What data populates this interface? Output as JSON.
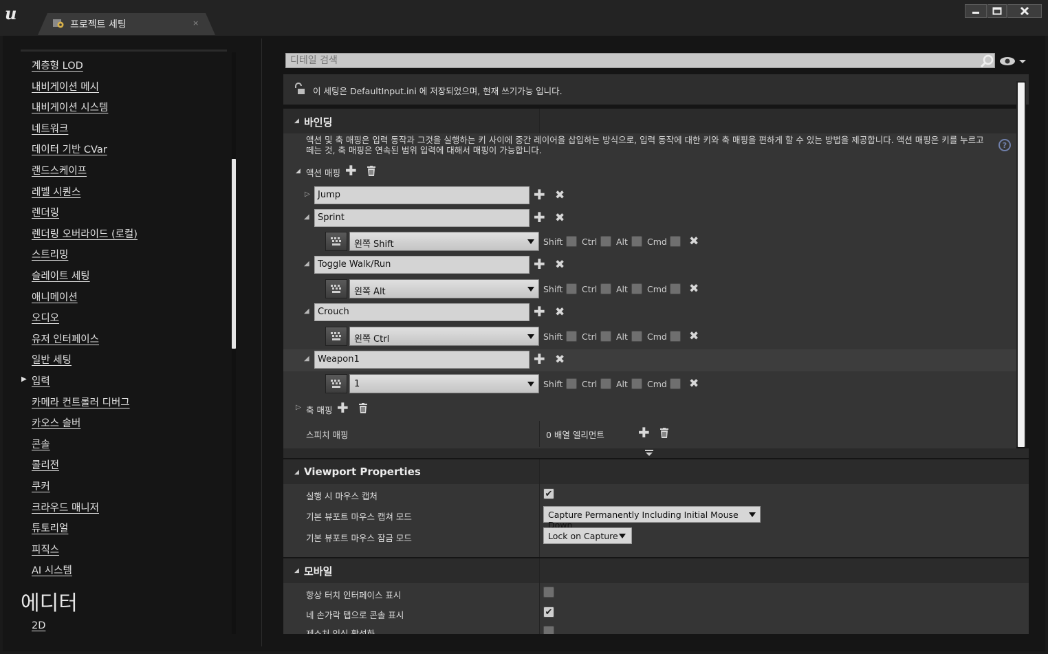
{
  "window": {
    "tab_label": "프로젝트 세팅",
    "tab_close": "×",
    "icons": {
      "logo": "unreal-logo",
      "tab": "settings-gear-icon",
      "minimize": "minimize-icon",
      "maximize": "maximize-icon",
      "close": "close-icon"
    }
  },
  "nav": {
    "items": [
      {
        "label": "계층형 LOD"
      },
      {
        "label": "내비게이션 메시"
      },
      {
        "label": "내비게이션 시스템"
      },
      {
        "label": "네트워크"
      },
      {
        "label": "데이터 기반 CVar"
      },
      {
        "label": "랜드스케이프"
      },
      {
        "label": "레벨 시퀀스"
      },
      {
        "label": "렌더링"
      },
      {
        "label": "렌더링 오버라이드 (로컬)"
      },
      {
        "label": "스트리밍"
      },
      {
        "label": "슬레이트 세팅"
      },
      {
        "label": "애니메이션"
      },
      {
        "label": "오디오"
      },
      {
        "label": "유저 인터페이스"
      },
      {
        "label": "일반 세팅"
      },
      {
        "label": "입력",
        "selected": true
      },
      {
        "label": "카메라 컨트롤러 디버그"
      },
      {
        "label": "카오스 솔버"
      },
      {
        "label": "콘솔"
      },
      {
        "label": "콜리전"
      },
      {
        "label": "쿠커"
      },
      {
        "label": "크라우드 매니저"
      },
      {
        "label": "튜토리얼"
      },
      {
        "label": "피직스"
      },
      {
        "label": "AI 시스템"
      }
    ],
    "section_title": "에디터",
    "section_first_item": "2D"
  },
  "details": {
    "search_placeholder": "디테일 검색",
    "info_text": "이 세팅은 DefaultInput.ini 에 저장되었으며, 현재 쓰기가능 입니다.",
    "bindings": {
      "title": "바인딩",
      "description_line1": "액션 및 축 매핑은 입력 동작과 그것을 실행하는 키 사이에 중간 레이어을 삽입하는 방식으로, 입력 동작에 대한 키와 축 매핑을 편하게 할 수 있는 방법을 제공합니다. 액션 매핑은 키를 누르고",
      "description_line2": "떼는 것, 축 매핑은 연속된 범위 입력에 대해서 매핑이 가능합니다.",
      "action_mappings_label": "액션 매핑",
      "axis_mappings_label": "축 매핑",
      "speech_mappings_label": "스피치 매핑",
      "speech_mappings_value": "0 배열 엘리먼트",
      "modifiers": [
        "Shift",
        "Ctrl",
        "Alt",
        "Cmd"
      ],
      "actions": [
        {
          "name": "Jump",
          "expanded": false,
          "keys": []
        },
        {
          "name": "Sprint",
          "expanded": true,
          "keys": [
            {
              "key": "왼쪽 Shift"
            }
          ]
        },
        {
          "name": "Toggle Walk/Run",
          "expanded": true,
          "keys": [
            {
              "key": "왼쪽 Alt"
            }
          ]
        },
        {
          "name": "Crouch",
          "expanded": true,
          "keys": [
            {
              "key": "왼쪽 Ctrl"
            }
          ]
        },
        {
          "name": "Weapon1",
          "expanded": true,
          "keys": [
            {
              "key": "1"
            }
          ]
        }
      ]
    },
    "viewport": {
      "title": "Viewport Properties",
      "props": [
        {
          "label": "실행 시 마우스 캡처",
          "checked": true
        },
        {
          "label": "기본 뷰포트 마우스 캡쳐 모드",
          "value": "Capture Permanently Including Initial Mouse Down"
        },
        {
          "label": "기본 뷰포트 마우스 잠금 모드",
          "value": "Lock on Capture"
        }
      ]
    },
    "mobile": {
      "title": "모바일",
      "props": [
        {
          "label": "항상 터치 인터페이스 표시",
          "checked": false
        },
        {
          "label": "네 손가락 탭으로 콘솔 표시",
          "checked": true
        },
        {
          "label": "제스처 인식 활성화",
          "checked": false
        }
      ]
    }
  }
}
